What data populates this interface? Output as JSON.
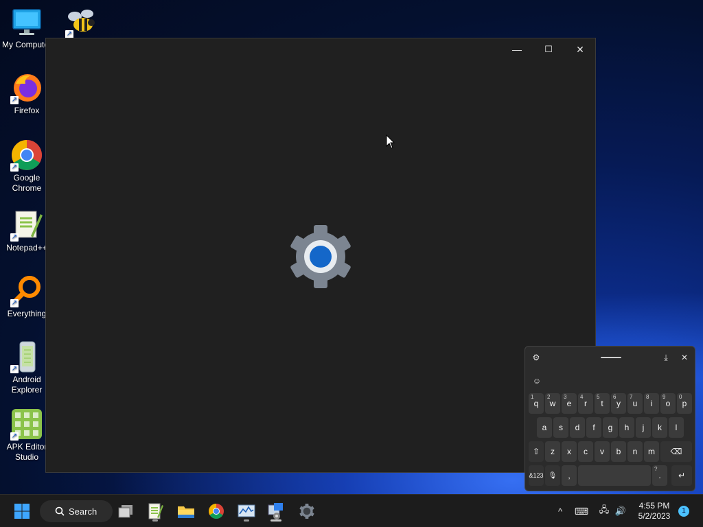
{
  "desktop": {
    "icons": [
      {
        "label": "My Computer",
        "icon": "monitor-icon"
      },
      {
        "label": "",
        "icon": "bee-icon"
      },
      {
        "label": "Firefox",
        "icon": "firefox-icon"
      },
      {
        "label": "Google Chrome",
        "icon": "chrome-icon"
      },
      {
        "label": "Notepad++",
        "icon": "notepadpp-icon"
      },
      {
        "label": "Everything",
        "icon": "everything-search-icon"
      },
      {
        "label": "Android Explorer",
        "icon": "android-explorer-icon"
      },
      {
        "label": "APK Editor Studio",
        "icon": "apk-editor-icon"
      }
    ]
  },
  "window": {
    "minimize": "—",
    "maximize": "☐",
    "close": "✕",
    "splash_icon": "settings-gear-icon"
  },
  "keyboard": {
    "settings_icon": "⚙",
    "dock_icon": "⤓",
    "close_icon": "✕",
    "emoji_icon": "☺",
    "row1": [
      {
        "k": "q",
        "n": "1"
      },
      {
        "k": "w",
        "n": "2"
      },
      {
        "k": "e",
        "n": "3"
      },
      {
        "k": "r",
        "n": "4"
      },
      {
        "k": "t",
        "n": "5"
      },
      {
        "k": "y",
        "n": "6"
      },
      {
        "k": "u",
        "n": "7"
      },
      {
        "k": "i",
        "n": "8"
      },
      {
        "k": "o",
        "n": "9"
      },
      {
        "k": "p",
        "n": "0"
      }
    ],
    "row2": [
      "a",
      "s",
      "d",
      "f",
      "g",
      "h",
      "j",
      "k",
      "l"
    ],
    "row3": [
      "z",
      "x",
      "c",
      "v",
      "b",
      "n",
      "m"
    ],
    "shift": "⇧",
    "backspace": "⌫",
    "symbols": "&123",
    "mic": "🎙",
    "comma": ",",
    "period": ".",
    "period_alt": "?",
    "enter": "↵"
  },
  "taskbar": {
    "search_label": "Search",
    "apps": [
      "task-view-icon",
      "notepadpp-icon",
      "file-explorer-icon",
      "chrome-icon",
      "resource-monitor-icon",
      "settings-app-icon",
      "settings-gear-icon"
    ],
    "tray": {
      "overflow": "^",
      "keyboard": "⌨",
      "network": "🖧",
      "volume": "🔊"
    },
    "time": "4:55 PM",
    "date": "5/2/2023",
    "notification_count": "1"
  }
}
